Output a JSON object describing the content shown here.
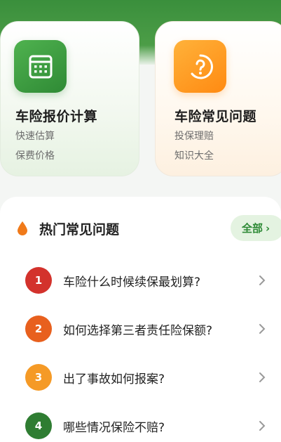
{
  "cards": [
    {
      "title": "车险报价计算",
      "sub1": "快速估算",
      "sub2": "保费价格",
      "icon": "calculator-icon"
    },
    {
      "title": "车险常见问题",
      "sub1": "投保理赔",
      "sub2": "知识大全",
      "icon": "question-icon"
    }
  ],
  "hot": {
    "title": "热门常见问题",
    "all_label": "全部",
    "all_chevron": "›"
  },
  "faqs": [
    {
      "num": "1",
      "text": "车险什么时候续保最划算?",
      "color": "#d3322c"
    },
    {
      "num": "2",
      "text": "如何选择第三者责任险保额?",
      "color": "#e8601e"
    },
    {
      "num": "3",
      "text": "出了事故如何报案?",
      "color": "#f59a26"
    },
    {
      "num": "4",
      "text": "哪些情况保险不赔?",
      "color": "#2f7d32"
    }
  ],
  "colors": {
    "accent_green": "#3a8f3c",
    "accent_orange": "#ff8a12",
    "drop": "#f07a1a"
  }
}
